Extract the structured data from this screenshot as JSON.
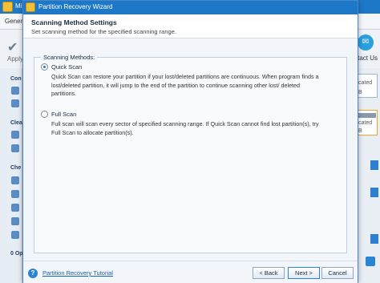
{
  "background": {
    "app_title": "Mi",
    "menu_item": "Gener",
    "apply_label": "Apply",
    "brand": "ool",
    "contact": "tact Us",
    "sidebar_headers": [
      "Con",
      "Clea",
      "Che"
    ],
    "status": "0 Op",
    "right_texts": [
      "cated",
      "B",
      "cated",
      "B"
    ]
  },
  "dialog": {
    "title": "Partition Recovery Wizard",
    "heading": "Scanning Method Settings",
    "subheading": "Set scanning method for the specified scanning range.",
    "group_label": "Scanning Methods:",
    "options": [
      {
        "label": "Quick Scan",
        "selected": true,
        "description": "Quick Scan can restore your partition if your lost/deleted partitions are continuous. When program finds a lost/deleted partition, it will jump to the end of the partition to continue scanning other lost/ deleted partitions."
      },
      {
        "label": "Full Scan",
        "selected": false,
        "description": "Full scan will scan every sector of specified scanning range. If Quick Scan cannot find lost partition(s), try Full Scan to allocate partition(s)."
      }
    ],
    "footer": {
      "help_link": "Partition Recovery Tutorial",
      "back_label": "< Back",
      "next_label": "Next >",
      "cancel_label": "Cancel"
    }
  },
  "colors": {
    "titlebar": "#1e78c8",
    "accent": "#2a84d2",
    "link": "#1a62b0"
  }
}
